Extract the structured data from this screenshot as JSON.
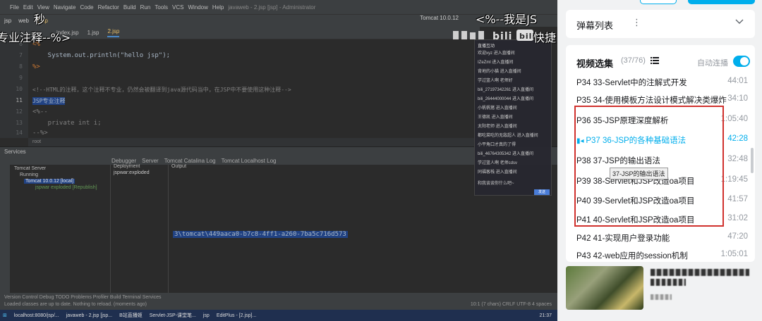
{
  "ide": {
    "menu": [
      "File",
      "Edit",
      "View",
      "Navigate",
      "Code",
      "Refactor",
      "Build",
      "Run",
      "Tools",
      "VCS",
      "Window",
      "Help",
      "javaweb - 2.jsp [jsp] - Administrator"
    ],
    "path": [
      "jsp",
      "web",
      "2.jsp"
    ],
    "run_config": "Tomcat 10.0.12",
    "tabs": [
      "index.jsp",
      "1.jsp",
      "2.jsp"
    ],
    "code_lines": [
      {
        "n": "6",
        "text": "<%"
      },
      {
        "n": "7",
        "text": "    System.out.println(\"hello jsp\");"
      },
      {
        "n": "8",
        "text": "%>"
      },
      {
        "n": "9",
        "text": ""
      },
      {
        "n": "10",
        "text": "<!--HTML的注释，这个注释不专业，仍然会被翻译到java源代码当中，在JSP中不要使用这种注释-->"
      },
      {
        "n": "11",
        "text": "JSP专业注释"
      },
      {
        "n": "12",
        "text": "<%--"
      },
      {
        "n": "13",
        "text": "    private int i;"
      },
      {
        "n": "14",
        "text": "--%>"
      }
    ],
    "editor_footer": "root",
    "services_label": "Services",
    "services_toolbar": [
      "Debugger",
      "Server",
      "Tomcat Catalina Log",
      "Tomcat Localhost Log"
    ],
    "tree": [
      "Tomcat Server",
      "Running",
      "Tomcat 10.0.12 [local]",
      "jspwar exploded [Republish]"
    ],
    "deployment_label": "Deployment",
    "deployment_item": "jspwar:exploded",
    "output_label": "Output",
    "output_line": "3\\tomcat\\449aaca0-b7c8-4ff1-a260-7ba5c716d573",
    "status_tabs": "Version Control   Debug   TODO   Problems   Profiler   Build   Terminal   Services",
    "status_msg": "Loaded classes are up to date. Nothing to reload. (moments ago)",
    "status_right": "10:1 (7 chars)  CRLF  UTF-8  4 spaces",
    "taskbar": [
      "localhost:8080/jsp/...",
      "javaweb - 2.jsp [jsp...",
      "B站直播姬",
      "Servlet-JSP-课堂笔...",
      "jsp",
      "EditPlus - [2.jsp]..."
    ],
    "clock": "21:37"
  },
  "stream_panel": {
    "header": "直播互动",
    "items": [
      "欢迎xyz 进入直播间",
      "IZeZml 进入直播间",
      "背地的小猫 进入直播间",
      "学过篮人啊 老师好",
      "bili_27197342261 进入直播间",
      "bili_26444000044 进入直播间",
      "小帆帆猪 进入直播间",
      "王德凯 进入直播间",
      "太阳老师 进入直播间",
      "都吃菜吃的无敌超人 进入直播间",
      "小平角口才真的了得",
      "bili_46764305342 进入直播间",
      "学过篮人啊 老师cdsv",
      "同福客栈 进入直播间",
      "和我谈谈你什么吧~"
    ],
    "send": "发送"
  },
  "danmaku": {
    "d1": "秒",
    "d2": "专业注释--%>",
    "d3": "<%--我是JS",
    "d4": "快捷"
  },
  "sidebar": {
    "danmaku_list": "弹幕列表",
    "more_icon": "⋮",
    "collapse_icon": "chevron-down",
    "selection_title": "视频选集",
    "selection_count": "(37/76)",
    "autoplay_label": "自动连播",
    "autoplay_on": true,
    "tooltip": "37-JSP的输出语法",
    "episodes": [
      {
        "title": "P34  33-Servlet中的注解式开发",
        "dur": "44:01"
      },
      {
        "title": "P35  34-使用模板方法设计模式解决类爆炸",
        "dur": "34:10"
      },
      {
        "title": "P36  35-JSP原理深度解析",
        "dur": "1:05:40"
      },
      {
        "title": "P37  36-JSP的各种基础语法",
        "dur": "42:28"
      },
      {
        "title": "P38  37-JSP的输出语法",
        "dur": "32:48"
      },
      {
        "title": "P39  38-Servlet和JSP改造oa项目",
        "dur": "1:19:45"
      },
      {
        "title": "P40  39-Servlet和JSP改造oa项目",
        "dur": "41:57"
      },
      {
        "title": "P41  40-Servlet和JSP改造oa项目",
        "dur": "31:02"
      },
      {
        "title": "P42  41-实现用户登录功能",
        "dur": "47:20"
      },
      {
        "title": "P43  42-web应用的session机制",
        "dur": "1:05:01"
      }
    ],
    "active_index": 3
  },
  "colors": {
    "accent": "#00aeec",
    "highlight_box": "#d0312d"
  }
}
